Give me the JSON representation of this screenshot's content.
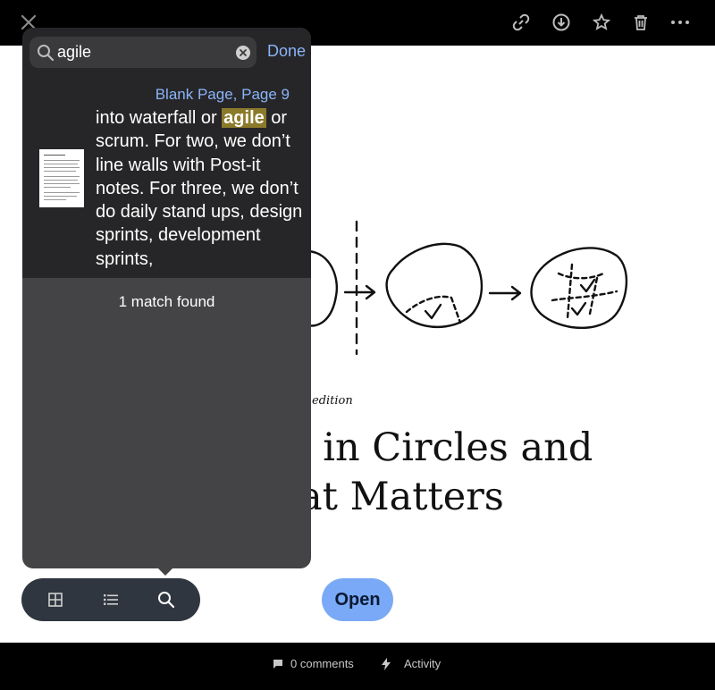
{
  "toolbar": {
    "close_icon": "close-icon",
    "actions": [
      "link-icon",
      "download-icon",
      "star-icon",
      "trash-icon",
      "more-icon"
    ]
  },
  "document": {
    "edition_text": "edition",
    "title_line1": "g in Circles and",
    "title_line2": "at Matters"
  },
  "search": {
    "query": "agile",
    "done_label": "Done",
    "result": {
      "location": "Blank Page, Page 9",
      "snippet_before": "into waterfall or ",
      "snippet_match": "agile",
      "snippet_after": " or scrum. For two, we don’t line walls with Post-it notes. For three, we don’t do daily stand ups, design sprints, development sprints,"
    },
    "match_count": "1 match found"
  },
  "tabs": [
    {
      "name": "grid-view",
      "icon": "grid-icon"
    },
    {
      "name": "list-view",
      "icon": "list-icon"
    },
    {
      "name": "search",
      "icon": "search-icon",
      "active": true
    }
  ],
  "open_label": "Open",
  "footer": {
    "comments_label": "0 comments",
    "activity_label": "Activity"
  },
  "colors": {
    "accent": "#8ab4f8",
    "open_button": "#7aa9f7",
    "highlight": "#8c7a2b"
  }
}
